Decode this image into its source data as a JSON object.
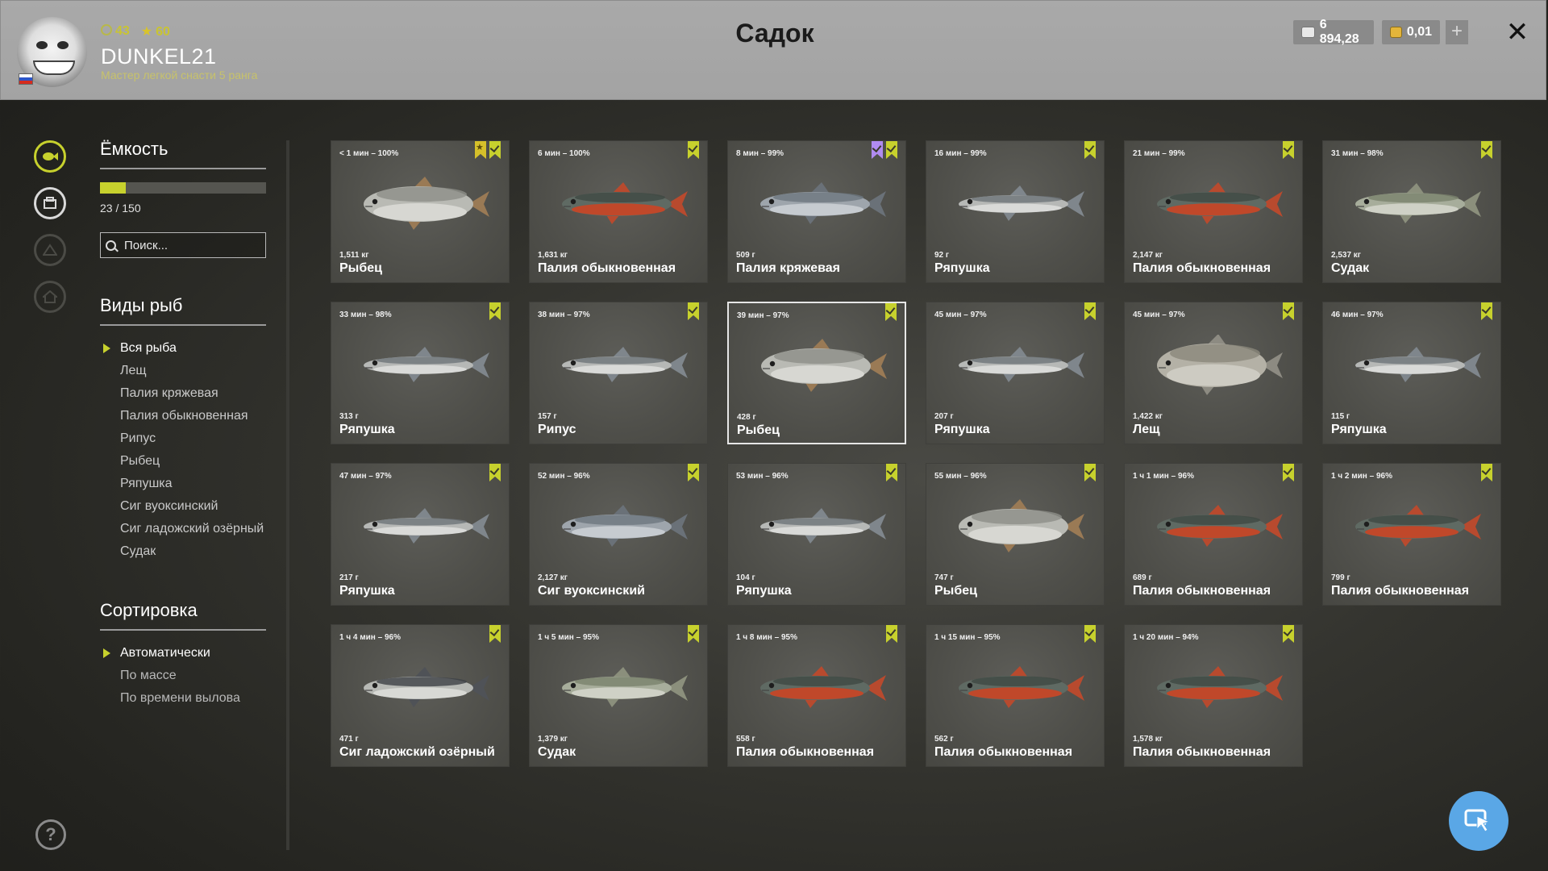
{
  "header": {
    "title": "Садок",
    "username": "DUNKEL21",
    "rank": "Мастер легкой снасти 5 ранга",
    "level": "43",
    "stars": "60",
    "silver": "6 894,28",
    "gold": "0,01",
    "add_label": "+",
    "close_label": "✕"
  },
  "capacity": {
    "title": "Ёмкость",
    "used": 23,
    "total": 150,
    "text": "23 / 150",
    "fill_fraction": 0.153
  },
  "search": {
    "placeholder": "Поиск..."
  },
  "species": {
    "title": "Виды рыб",
    "items": [
      "Вся рыба",
      "Лещ",
      "Палия кряжевая",
      "Палия обыкновенная",
      "Рипус",
      "Рыбец",
      "Ряпушка",
      "Сиг вуоксинский",
      "Сиг ладожский озёрный",
      "Судак"
    ],
    "active": 0
  },
  "sorting": {
    "title": "Сортировка",
    "items": [
      "Автоматически",
      "По массе",
      "По времени вылова"
    ],
    "active": 0
  },
  "colors": {
    "accent": "#c7d12d",
    "gold": "#d6c02a",
    "purple": "#b08bf0",
    "fab": "#5aa7e6"
  },
  "fish": [
    {
      "time": "< 1 мин – 100%",
      "weight": "1,511 кг",
      "name": "Рыбец",
      "type": "whitefish",
      "extra": "star"
    },
    {
      "time": "6 мин – 100%",
      "weight": "1,631 кг",
      "name": "Палия обыкновенная",
      "type": "char"
    },
    {
      "time": "8 мин – 99%",
      "weight": "509 г",
      "name": "Палия кряжевая",
      "type": "silverchar",
      "extra": "purple"
    },
    {
      "time": "16 мин – 99%",
      "weight": "92 г",
      "name": "Ряпушка",
      "type": "vendace"
    },
    {
      "time": "21 мин – 99%",
      "weight": "2,147 кг",
      "name": "Палия обыкновенная",
      "type": "char"
    },
    {
      "time": "31 мин – 98%",
      "weight": "2,537 кг",
      "name": "Судак",
      "type": "zander"
    },
    {
      "time": "33 мин – 98%",
      "weight": "313 г",
      "name": "Ряпушка",
      "type": "vendace"
    },
    {
      "time": "38 мин – 97%",
      "weight": "157 г",
      "name": "Рипус",
      "type": "vendace"
    },
    {
      "time": "39 мин – 97%",
      "weight": "428 г",
      "name": "Рыбец",
      "type": "whitefish",
      "selected": true
    },
    {
      "time": "45 мин – 97%",
      "weight": "207 г",
      "name": "Ряпушка",
      "type": "vendace"
    },
    {
      "time": "45 мин – 97%",
      "weight": "1,422 кг",
      "name": "Лещ",
      "type": "bream"
    },
    {
      "time": "46 мин – 97%",
      "weight": "115 г",
      "name": "Ряпушка",
      "type": "vendace"
    },
    {
      "time": "47 мин – 97%",
      "weight": "217 г",
      "name": "Ряпушка",
      "type": "vendace"
    },
    {
      "time": "52 мин – 96%",
      "weight": "2,127 кг",
      "name": "Сиг вуоксинский",
      "type": "silverchar"
    },
    {
      "time": "53 мин – 96%",
      "weight": "104 г",
      "name": "Ряпушка",
      "type": "vendace"
    },
    {
      "time": "55 мин – 96%",
      "weight": "747 г",
      "name": "Рыбец",
      "type": "whitefish"
    },
    {
      "time": "1 ч 1 мин – 96%",
      "weight": "689 г",
      "name": "Палия обыкновенная",
      "type": "char"
    },
    {
      "time": "1 ч 2 мин – 96%",
      "weight": "799 г",
      "name": "Палия обыкновенная",
      "type": "char"
    },
    {
      "time": "1 ч 4 мин – 96%",
      "weight": "471 г",
      "name": "Сиг ладожский озёрный",
      "type": "darkwhite"
    },
    {
      "time": "1 ч 5 мин – 95%",
      "weight": "1,379 кг",
      "name": "Судак",
      "type": "zander"
    },
    {
      "time": "1 ч 8 мин – 95%",
      "weight": "558 г",
      "name": "Палия обыкновенная",
      "type": "char"
    },
    {
      "time": "1 ч 15 мин – 95%",
      "weight": "562 г",
      "name": "Палия обыкновенная",
      "type": "char"
    },
    {
      "time": "1 ч 20 мин – 94%",
      "weight": "1,578 кг",
      "name": "Палия обыкновенная",
      "type": "char"
    }
  ]
}
